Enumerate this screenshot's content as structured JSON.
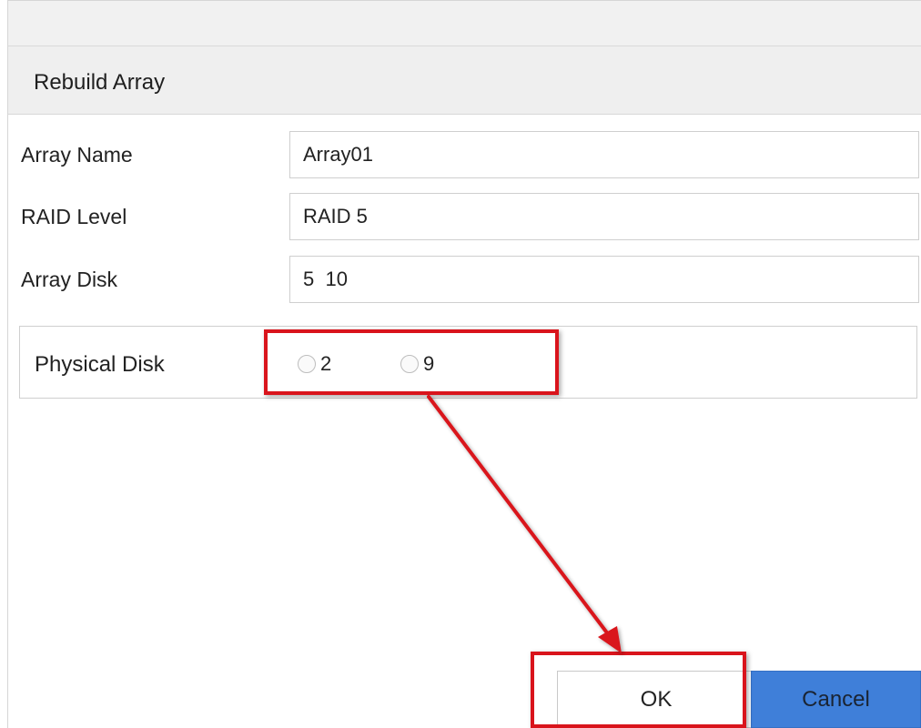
{
  "dialog": {
    "title": "Rebuild Array"
  },
  "form": {
    "array_name": {
      "label": "Array Name",
      "value": "Array01"
    },
    "raid_level": {
      "label": "RAID Level",
      "value": "RAID 5"
    },
    "array_disk": {
      "label": "Array Disk",
      "value": "5  10"
    }
  },
  "physical_disk": {
    "label": "Physical Disk",
    "options": [
      {
        "label": "2",
        "selected": false
      },
      {
        "label": "9",
        "selected": false
      }
    ]
  },
  "buttons": {
    "ok": "OK",
    "cancel": "Cancel"
  },
  "annotation": {
    "highlight_color": "#d9141c"
  },
  "colors": {
    "cancel_button": "#3f7fd9",
    "title_bar": "#efefef"
  }
}
